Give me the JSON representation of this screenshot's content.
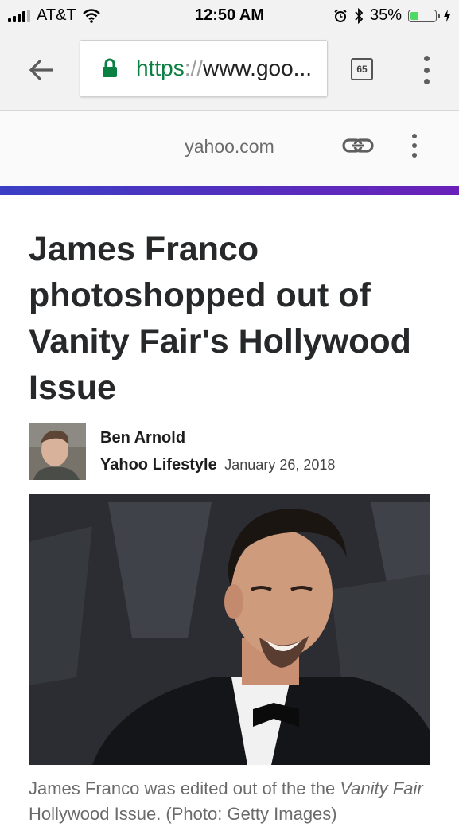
{
  "status_bar": {
    "carrier": "AT&T",
    "time": "12:50 AM",
    "battery_percent": "35%",
    "battery_level": 0.35,
    "battery_color": "#4cd964"
  },
  "browser": {
    "url_scheme": "https",
    "url_separator": "://",
    "url_rest": "www.goo...",
    "tab_count": "65",
    "secure_color": "#0b8043"
  },
  "site": {
    "domain": "yahoo.com"
  },
  "article": {
    "headline": "James Franco photoshopped out of Vanity Fair's Hollywood Issue",
    "author": "Ben Arnold",
    "publication": "Yahoo Lifestyle",
    "date": "January 26, 2018",
    "caption_start": "James Franco was edited out of the the ",
    "caption_italic_1": "Vanity Fair",
    "caption_mid": " Hollywood Issue. (Photo: Getty Images)"
  },
  "icons": {
    "back": "arrow-left-icon",
    "lock": "lock-icon",
    "link": "link-icon",
    "menu": "vertical-dots-icon",
    "wifi": "wifi-icon",
    "alarm": "alarm-icon",
    "bluetooth": "bluetooth-icon",
    "charging": "bolt-icon"
  },
  "colors": {
    "accent_start": "#3a3fc4",
    "accent_end": "#6a20b9",
    "headline": "#26282a"
  }
}
